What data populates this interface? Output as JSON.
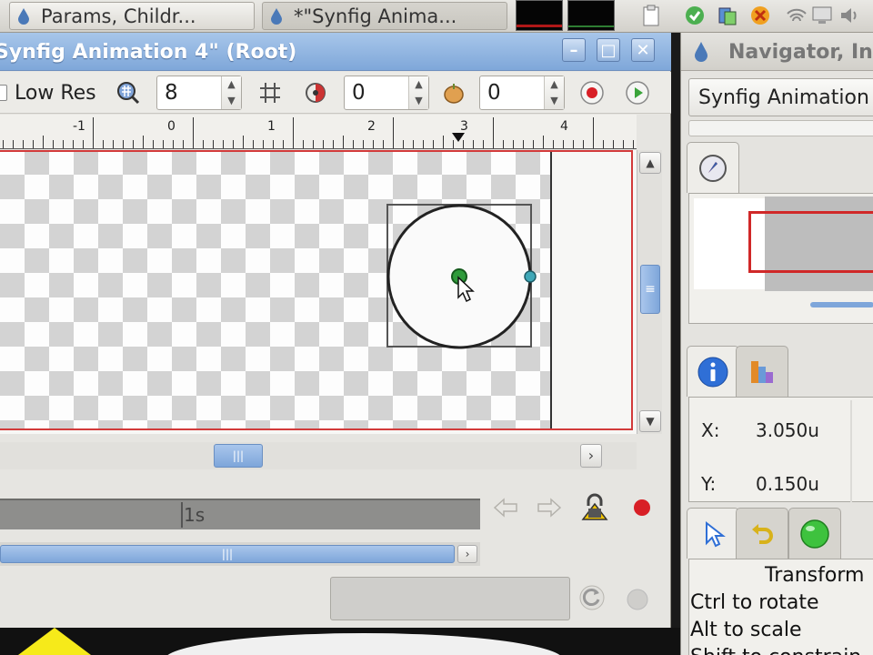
{
  "taskbar": {
    "tasks": [
      {
        "label": "Params, Childr..."
      },
      {
        "label": "*\"Synfig Anima..."
      }
    ]
  },
  "canvas_window": {
    "title": "Synfig Animation 4\" (Root)",
    "buttons": {
      "minimize": "–",
      "maximize": "□",
      "close": "✕"
    },
    "toolbar": {
      "low_res_label": "Low Res",
      "pixel_size_value": "8",
      "onion_past_value": "0",
      "onion_future_value": "0"
    },
    "ruler": {
      "labels": [
        "-1",
        "0",
        "1",
        "2",
        "3",
        "4"
      ]
    },
    "timebar": {
      "time_label": "1s"
    }
  },
  "navigator_panel": {
    "title": "Navigator, In",
    "canvas_select": "Synfig Animation",
    "info": {
      "x_label": "X:",
      "x_value": "3.050u",
      "y_label": "Y:",
      "y_value": "0.150u"
    },
    "tool_help": {
      "title": "Transform",
      "lines": [
        "Ctrl to rotate",
        "Alt to scale",
        "Shift to constrain"
      ]
    }
  },
  "colors": {
    "title_bar": "#7fa7d9",
    "canvas_frame": "#d23a3a",
    "record_red": "#d81f26",
    "duck_green": "#2e9b3a"
  }
}
